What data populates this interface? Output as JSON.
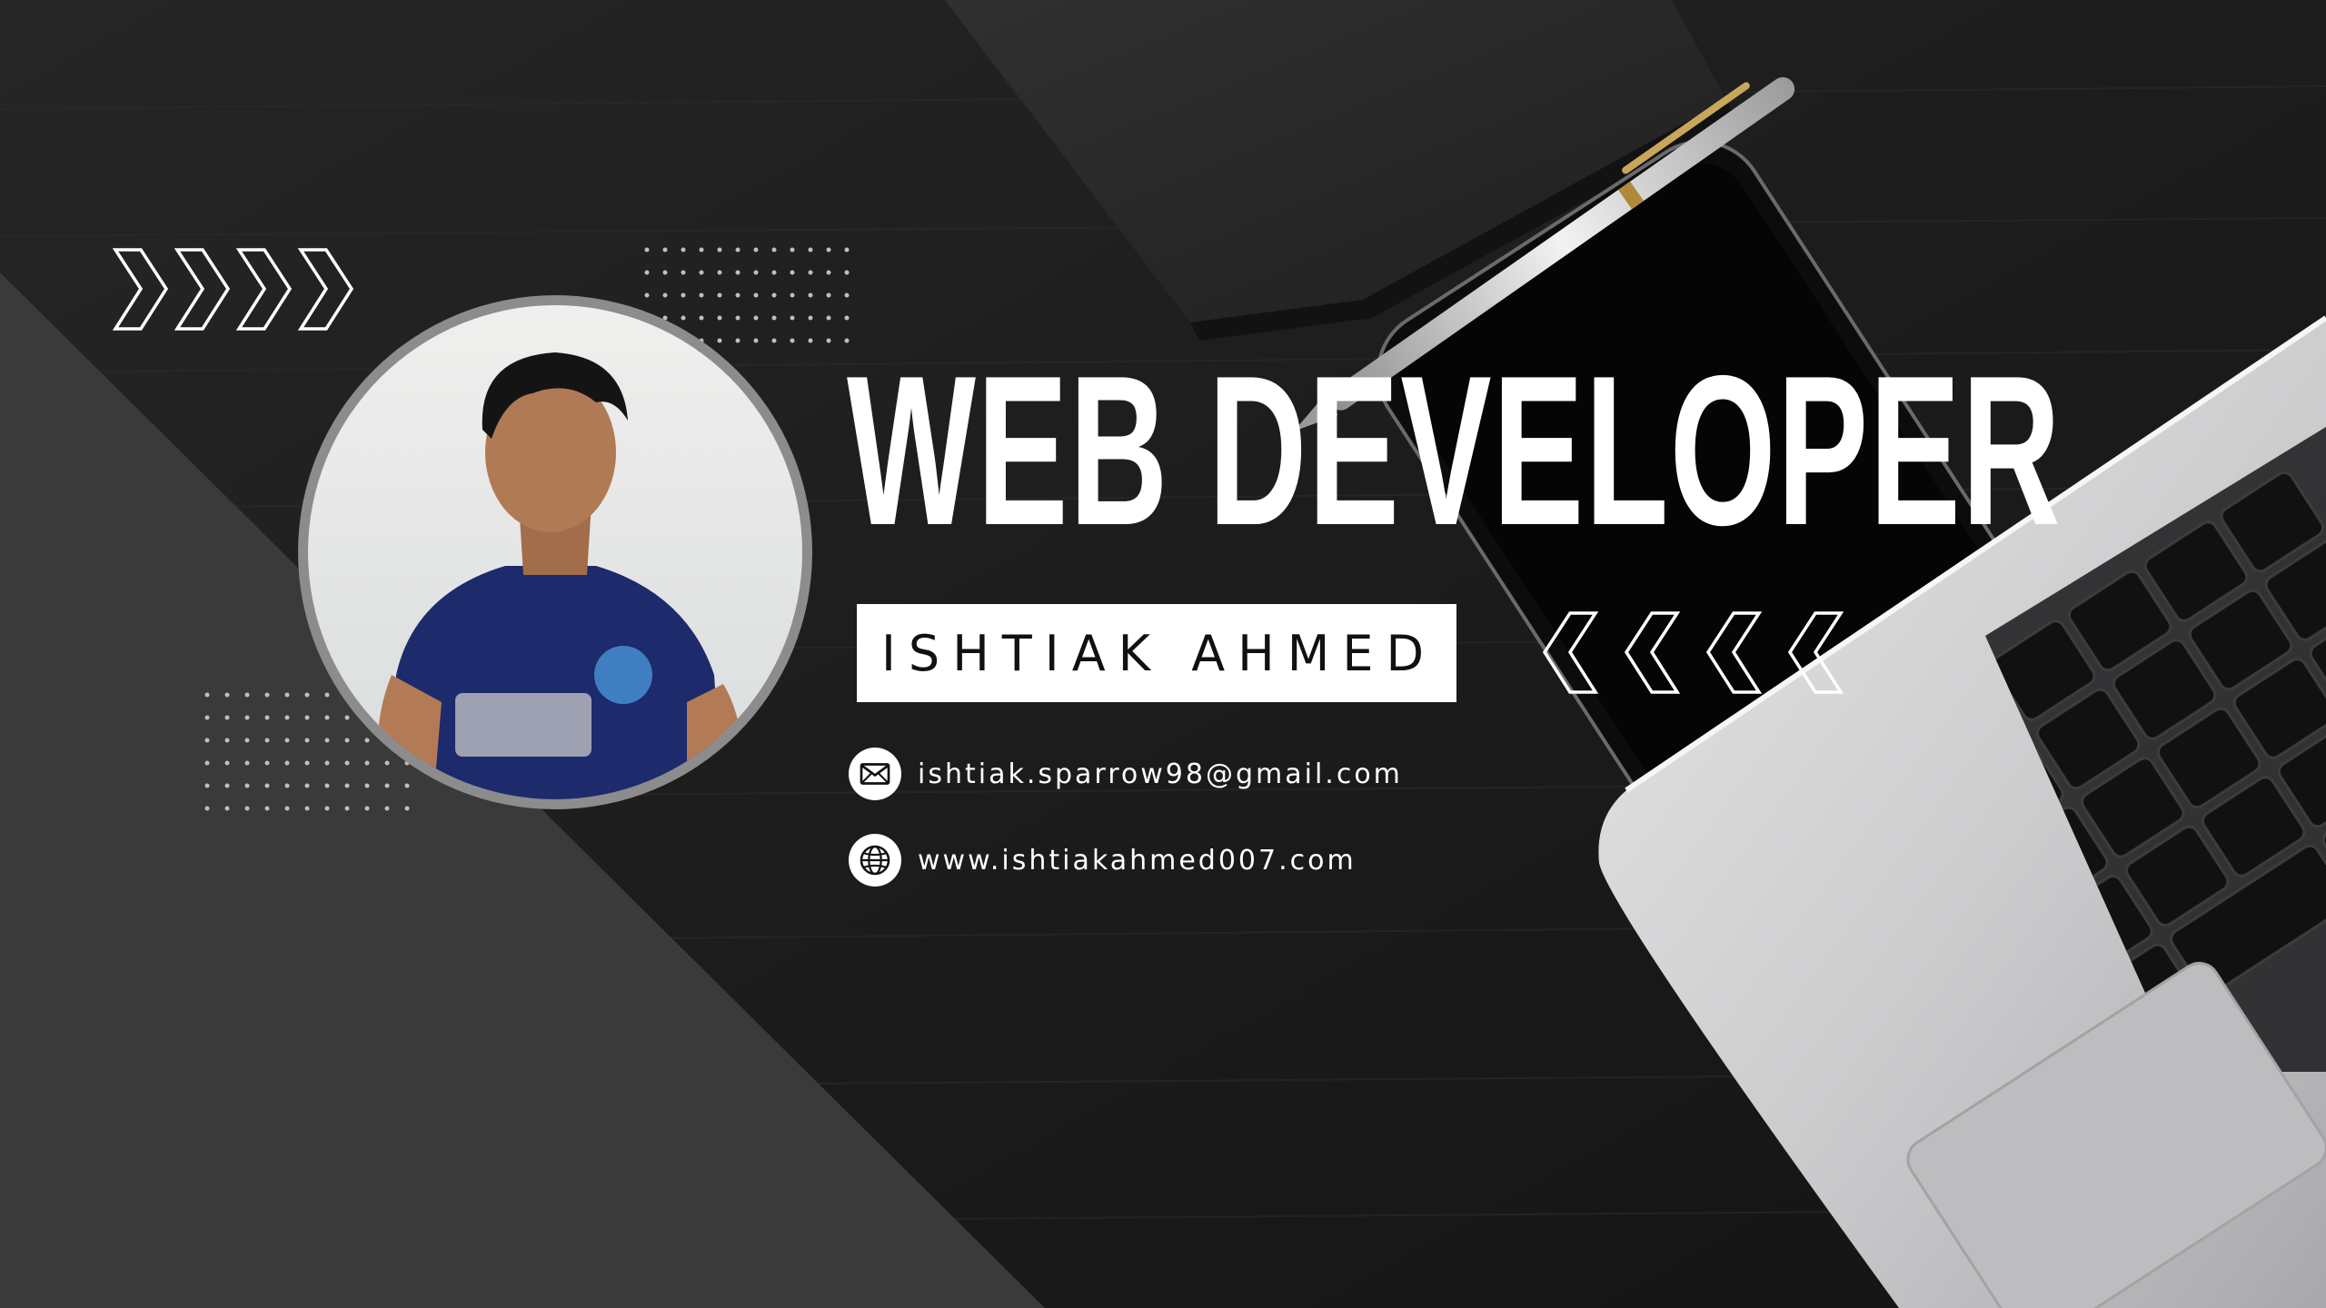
{
  "banner": {
    "title": "WEB DEVELOPER",
    "name": "ISHTIAK AHMED",
    "email": "ishtiak.sparrow98@gmail.com",
    "website": "www.ishtiakahmed007.com"
  },
  "icons": {
    "email": "envelope-icon",
    "website": "globe-icon",
    "decoration_left": "chevrons-right-icon",
    "decoration_right": "chevrons-left-icon"
  },
  "colors": {
    "background": "#1b1b1b",
    "panel": "#3a3a3a",
    "text": "#ffffff",
    "name_box": "#ffffff",
    "name_text": "#111111"
  }
}
